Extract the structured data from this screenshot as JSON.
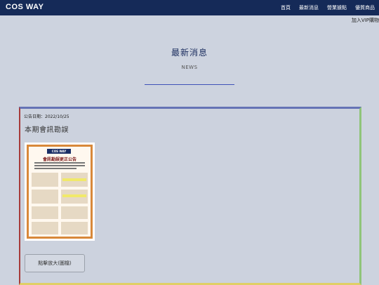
{
  "header": {
    "logo": "COS WAY",
    "nav": [
      "首頁",
      "最新消息",
      "營業據點",
      "優質商品"
    ],
    "join_link": "加入VIP購物"
  },
  "main": {
    "title": "最新消息",
    "subtitle": "NEWS"
  },
  "post": {
    "date": "公告日期：2022/10/25",
    "title": "本期會訊勘誤",
    "poster_brand": "COS WAY",
    "poster_title": "會訊勘誤更正公告",
    "zoom_button": "點擊放大(圖檔)"
  },
  "colors": {
    "header_bg": "#152a58",
    "accent_line": "#3e52b7",
    "page_bg": "#cdd3df"
  }
}
